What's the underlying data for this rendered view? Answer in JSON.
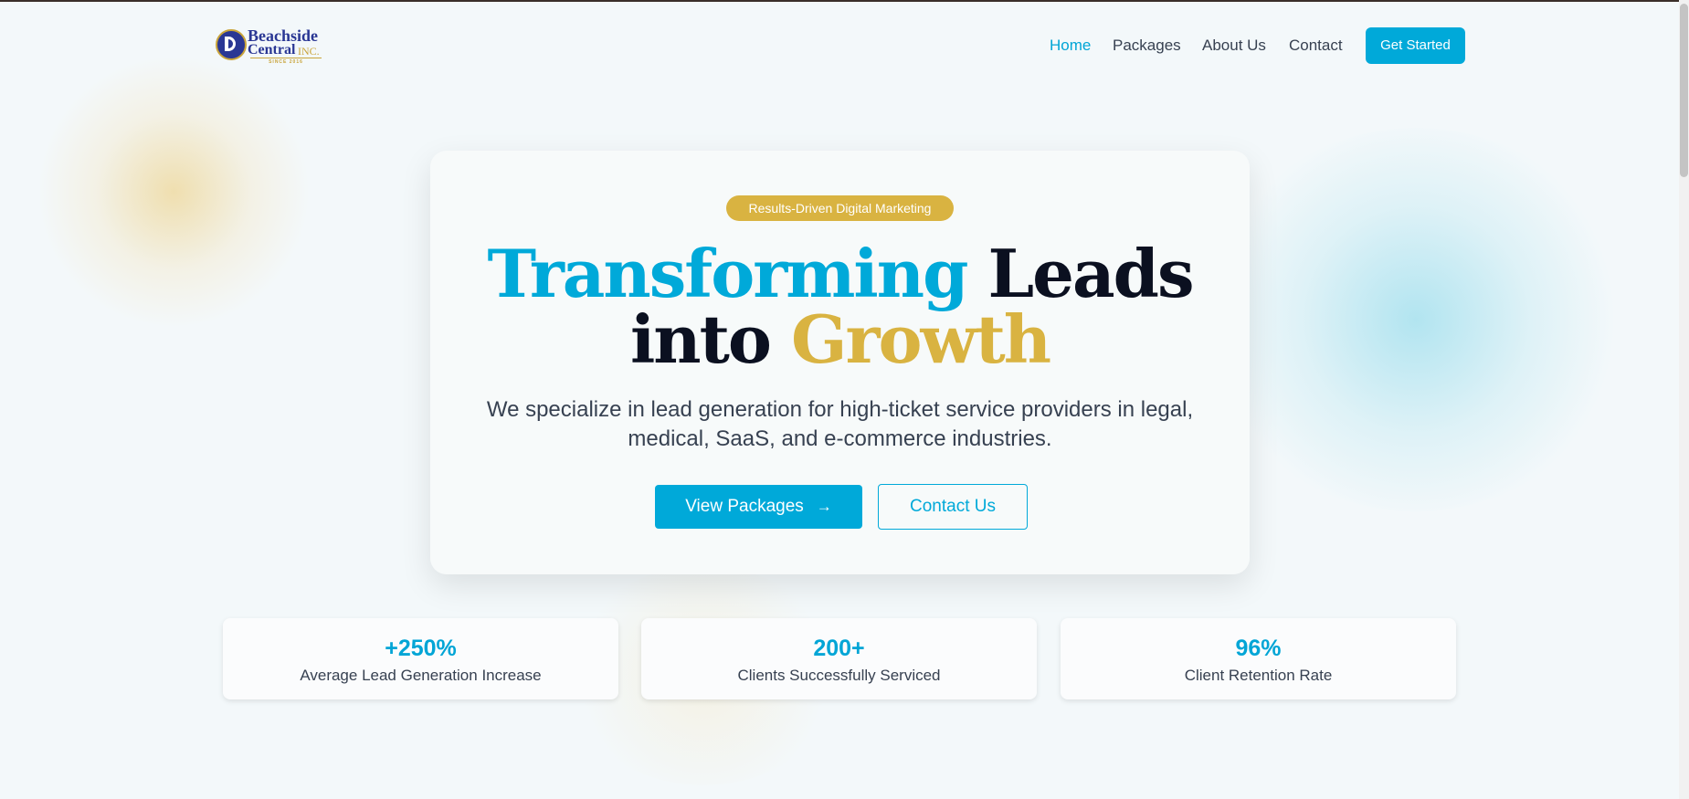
{
  "brand": {
    "name_line1": "Beachside",
    "name_line2": "Central",
    "suffix": "INC.",
    "since": "SINCE 2016",
    "primary_color": "#2a3794",
    "gold_color": "#c9a43a"
  },
  "nav": {
    "items": [
      {
        "label": "Home",
        "active": true
      },
      {
        "label": "Packages",
        "active": false
      },
      {
        "label": "About Us",
        "active": false
      },
      {
        "label": "Contact",
        "active": false
      }
    ],
    "cta_label": "Get Started"
  },
  "hero": {
    "badge": "Results-Driven Digital Marketing",
    "headline": {
      "word1": "Transforming",
      "word2": "Leads",
      "word3": "into",
      "word4": "Growth"
    },
    "subtitle": "We specialize in lead generation for high-ticket service providers in legal, medical, SaaS, and e-commerce industries.",
    "primary_button": "View Packages",
    "primary_button_icon": "arrow-right-icon",
    "secondary_button": "Contact Us"
  },
  "stats": [
    {
      "value": "+250%",
      "label": "Average Lead Generation Increase"
    },
    {
      "value": "200+",
      "label": "Clients Successfully Serviced"
    },
    {
      "value": "96%",
      "label": "Client Retention Rate"
    }
  ],
  "colors": {
    "accent": "#00a9d9",
    "gold": "#d9b341",
    "heading": "#0b1020",
    "background": "#f3f8fa"
  }
}
